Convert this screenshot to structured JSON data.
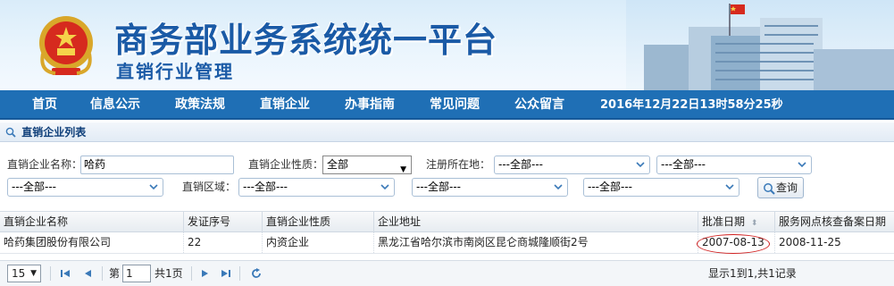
{
  "header": {
    "title": "商务部业务系统统一平台",
    "subtitle": "直销行业管理",
    "colors": {
      "brand_blue": "#1a5aa6",
      "nav_blue": "#1f6fb5"
    }
  },
  "nav": {
    "items": [
      "首页",
      "信息公示",
      "政策法规",
      "直销企业",
      "办事指南",
      "常见问题",
      "公众留言"
    ],
    "datetime": "2016年12月22日13时58分25秒"
  },
  "panel": {
    "title": "直销企业列表",
    "icon": "search-icon"
  },
  "filters": {
    "company_name_label": "直销企业名称：",
    "company_name_value": "哈药",
    "nature_label": "直销企业性质：",
    "nature_value": "全部",
    "registered_label": "注册所在地：",
    "registered_province": "---全部---",
    "registered_city": "---全部---",
    "registered_district": "---全部---",
    "area_label": "直销区域：",
    "area_1": "---全部---",
    "area_2": "---全部---",
    "area_3": "---全部---",
    "search_button": "查询"
  },
  "table": {
    "headers": [
      "直销企业名称",
      "发证序号",
      "直销企业性质",
      "企业地址",
      "批准日期",
      "服务网点核查备案日期"
    ],
    "rows": [
      [
        "哈药集团股份有限公司",
        "22",
        "内资企业",
        "黑龙江省哈尔滨市南岗区昆仑商城隆顺街2号",
        "2007-08-13",
        "2008-11-25"
      ]
    ]
  },
  "pager": {
    "page_size": "15",
    "page_prefix": "第",
    "page_value": "1",
    "page_suffix": "共1页",
    "summary": "显示1到1,共1记录"
  }
}
